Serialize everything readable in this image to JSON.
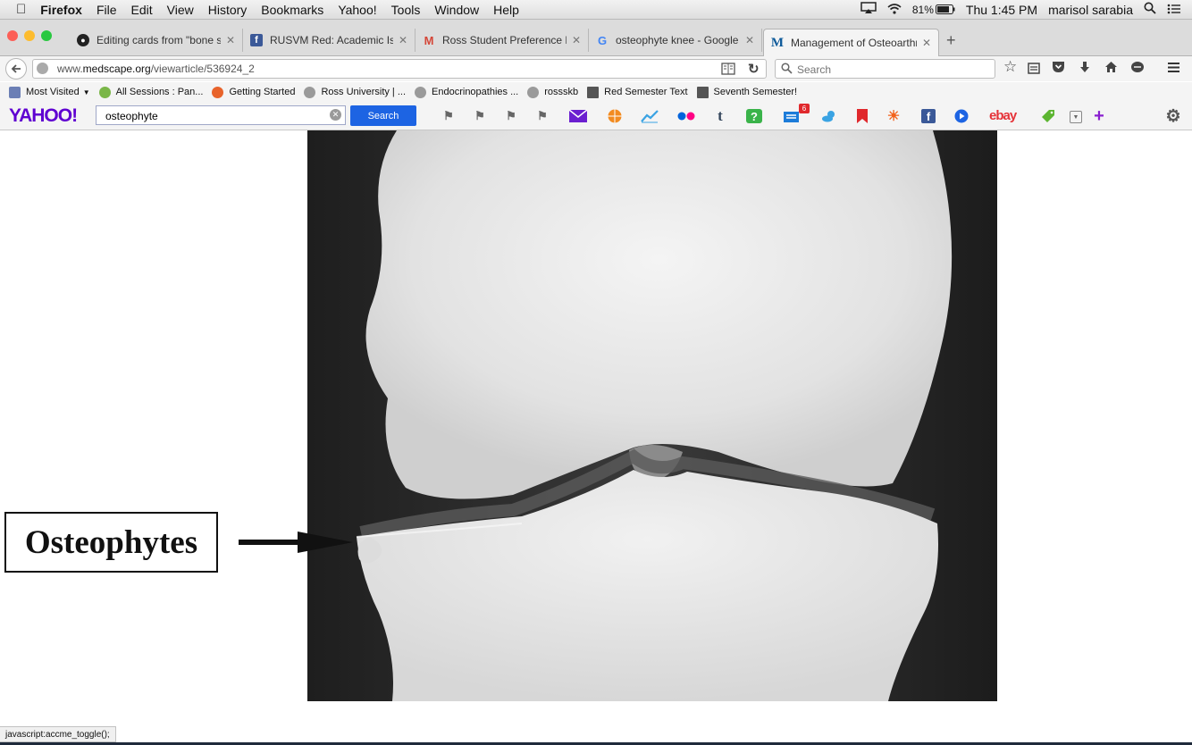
{
  "menubar": {
    "apple": "",
    "app": "Firefox",
    "items": [
      "File",
      "Edit",
      "View",
      "History",
      "Bookmarks",
      "Yahoo!",
      "Tools",
      "Window",
      "Help"
    ],
    "battery": "81%",
    "clock": "Thu 1:45 PM",
    "user": "marisol sarabia"
  },
  "tabs": [
    {
      "title": "Editing cards from \"bone s...",
      "active": false
    },
    {
      "title": "RUSVM Red: Academic Iss...",
      "active": false
    },
    {
      "title": "Ross Student Preference F...",
      "active": false
    },
    {
      "title": "osteophyte knee - Google ...",
      "active": false
    },
    {
      "title": "Management of Osteoarthri...",
      "active": true
    }
  ],
  "navbar": {
    "url_prefix": "www.",
    "url_domain": "medscape.org",
    "url_path": "/viewarticle/536924_2",
    "search_placeholder": "Search"
  },
  "bookmarks": [
    {
      "label": "Most Visited",
      "color": "#6b7fb5"
    },
    {
      "label": "All Sessions : Pan...",
      "color": "#7ab648"
    },
    {
      "label": "Getting Started",
      "color": "#e8632b"
    },
    {
      "label": "Ross University | ...",
      "color": "#9a9a9a"
    },
    {
      "label": "Endocrinopathies ...",
      "color": "#9a9a9a"
    },
    {
      "label": "rossskb",
      "color": "#9a9a9a"
    },
    {
      "label": "Red Semester Text",
      "color": "#555555"
    },
    {
      "label": "Seventh Semester!",
      "color": "#555555"
    }
  ],
  "yahoo": {
    "logo": "YAHOO!",
    "query": "osteophyte",
    "search_button": "Search",
    "ebay": "ebay",
    "badge": "6"
  },
  "figure": {
    "label": "Osteophytes"
  },
  "status": "javascript:accme_toggle();",
  "colors": {
    "yahoo_purple": "#5f01d1",
    "search_blue": "#1d64e3"
  }
}
